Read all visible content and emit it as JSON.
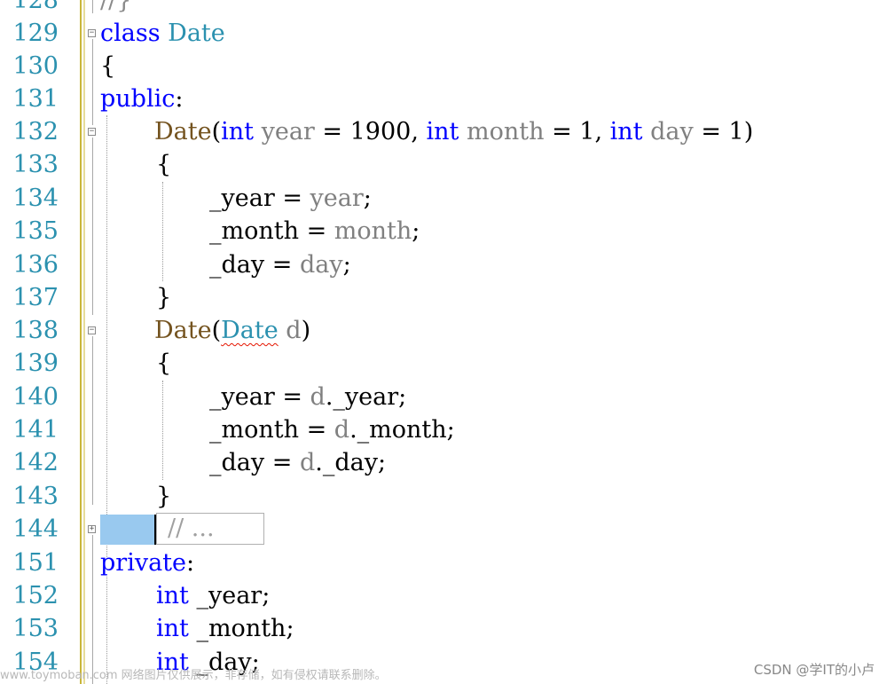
{
  "colors": {
    "keyword": "#0000ff",
    "type": "#2b91af",
    "function": "#74531f",
    "parameter": "#808080",
    "line_number": "#2b91af",
    "highlight": "#99c9ef"
  },
  "editor": {
    "top_partial": {
      "num": "128",
      "text": "//}"
    },
    "lines": [
      {
        "num": "129",
        "kw": "class",
        "name": "Date"
      },
      {
        "num": "130",
        "text": "{"
      },
      {
        "num": "131",
        "kw": "public",
        "punct": ":"
      },
      {
        "num": "132",
        "fn": "Date",
        "p1": "(",
        "k1": "int",
        "a1": "year",
        "o1": " = 1900, ",
        "k2": "int",
        "a2": "month",
        "o2": " = 1, ",
        "k3": "int",
        "a3": "day",
        "o3": " = 1)"
      },
      {
        "num": "133",
        "text": "{"
      },
      {
        "num": "134",
        "lhs": "_year",
        "eq": " = ",
        "rhs": "year",
        "end": ";"
      },
      {
        "num": "135",
        "lhs": "_month",
        "eq": " = ",
        "rhs": "month",
        "end": ";"
      },
      {
        "num": "136",
        "lhs": "_day",
        "eq": " = ",
        "rhs": "day",
        "end": ";"
      },
      {
        "num": "137",
        "text": "}"
      },
      {
        "num": "138",
        "fn": "Date",
        "p1": "(",
        "type": "Date",
        "space": " ",
        "arg": "d",
        "p2": ")"
      },
      {
        "num": "139",
        "text": "{"
      },
      {
        "num": "140",
        "lhs": "_year",
        "eq": " = ",
        "rhs": "d",
        "end": "._year;"
      },
      {
        "num": "141",
        "lhs": "_month",
        "eq": " = ",
        "rhs": "d",
        "end": "._month;"
      },
      {
        "num": "142",
        "lhs": "_day",
        "eq": " = ",
        "rhs": "d",
        "end": "._day;"
      },
      {
        "num": "143",
        "text": "}"
      },
      {
        "num": "144",
        "collapsed": "// ..."
      },
      {
        "num": "151",
        "kw": "private",
        "punct": ":"
      },
      {
        "num": "152",
        "kw": "int",
        "field": " _year;"
      },
      {
        "num": "153",
        "kw": "int",
        "field": " _month;"
      },
      {
        "num": "154",
        "kw": "int",
        "field": " _day;"
      }
    ]
  },
  "watermarks": {
    "left": "www.toymoban.com 网络图片仅供展示，非存储，如有侵权请联系删除。",
    "right": "CSDN @学IT的小卢"
  }
}
